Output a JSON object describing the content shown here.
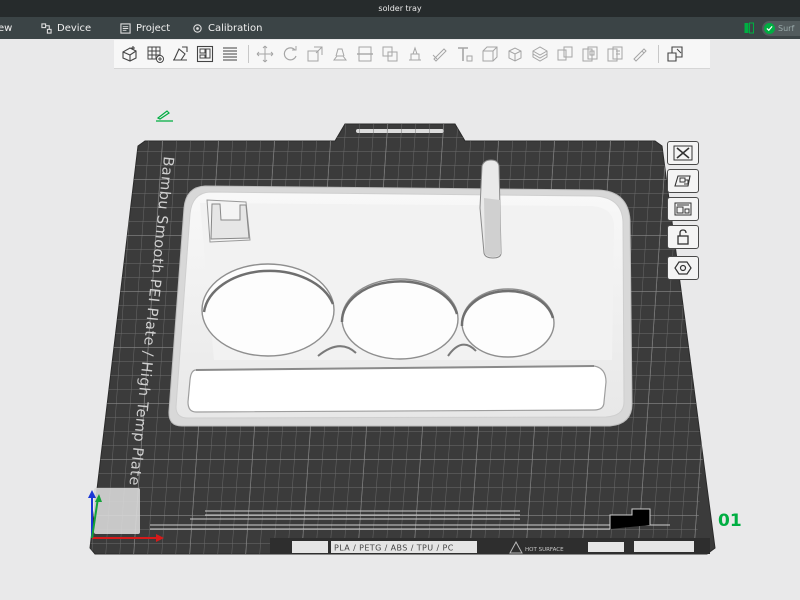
{
  "window": {
    "title": "solder tray"
  },
  "menu": {
    "items": [
      {
        "label": "ew",
        "icon": ""
      },
      {
        "label": "Device",
        "icon": "device-icon"
      },
      {
        "label": "Project",
        "icon": "project-icon"
      },
      {
        "label": "Calibration",
        "icon": "calibration-icon"
      }
    ]
  },
  "status": {
    "connected_color": "#00ae42",
    "surface_label": "Surf"
  },
  "toolbar": {
    "icons": [
      "add-object-icon",
      "add-plate-icon",
      "auto-orient-icon",
      "arrange-icon",
      "split-layers-icon",
      "move-icon",
      "rotate-icon",
      "scale-icon",
      "lay-on-face-icon",
      "cut-icon",
      "mesh-boolean-icon",
      "support-paint-icon",
      "seam-paint-icon",
      "text-icon",
      "measure-icon",
      "assemble-icon",
      "variable-layer-icon",
      "split-objects-icon",
      "split-parts-icon",
      "plate-list-icon",
      "brim-ears-icon"
    ]
  },
  "plate": {
    "label_text": "Bambu Smooth PEI Plate / High Temp Plate",
    "filament_text": "PLA / PETG / ABS / TPU / PC",
    "surface_text": "HOT SURFACE",
    "number": "01",
    "accent_color": "#00ae42",
    "plate_color": "#3d3d3d",
    "grid_color": "#6b6b6b"
  },
  "side_toolbar": {
    "buttons": [
      "close-icon",
      "auto-arrange-icon",
      "orient-icon",
      "lock-icon",
      "settings-icon"
    ]
  },
  "model": {
    "name": "solder tray",
    "color": "#f5f5f5"
  }
}
